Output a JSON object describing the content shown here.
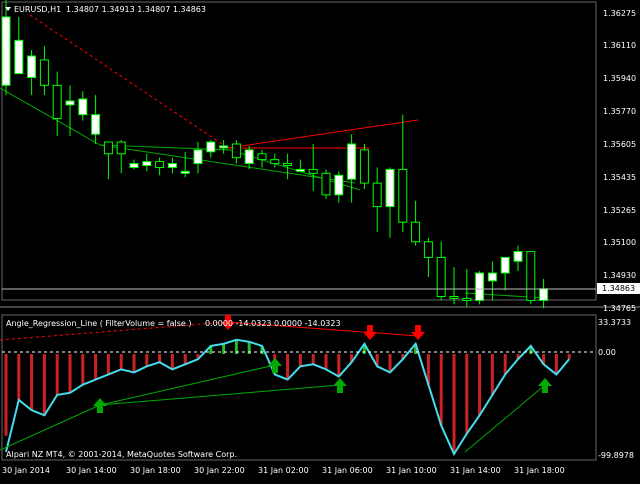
{
  "main": {
    "header": {
      "symbol": "EURUSD,H1",
      "ohlc": "1.34807 1.34913 1.34807 1.34863"
    },
    "price_axis": {
      "ticks": [
        "1.36275",
        "1.36110",
        "1.35940",
        "1.35770",
        "1.35605",
        "1.35435",
        "1.35265",
        "1.35100",
        "1.34930"
      ],
      "current_price": "1.34863",
      "bottom_label": "1.34765"
    }
  },
  "indicator": {
    "header": {
      "title": "Angle_Regression_Line ( FilterVolume = false )",
      "values": "0.0000 -14.0323 0.0000 -14.0323"
    },
    "axis": {
      "top": "33.3733",
      "zero": "0.00",
      "bottom": "-99.8978"
    }
  },
  "time_axis": {
    "labels": [
      "30 Jan 2014",
      "30 Jan 14:00",
      "30 Jan 18:00",
      "30 Jan 22:00",
      "31 Jan 02:00",
      "31 Jan 06:00",
      "31 Jan 10:00",
      "31 Jan 14:00",
      "31 Jan 18:00"
    ]
  },
  "footer": {
    "copyright": "Alpari NZ MT4, © 2001-2014, MetaQuotes Software Corp."
  },
  "colors": {
    "background": "#000000",
    "bull_candle": "#ffffff",
    "bear_candle": "#000000",
    "candle_outline": "#00ff00",
    "regression_line": "#00aa00",
    "trend_line": "#ff0000",
    "osc_line": "#44ddee",
    "hist_neg": "#cc2222",
    "hist_pos": "#22bb22",
    "arrow_up": "#00aa00",
    "arrow_down": "#ff0000"
  },
  "chart_data": {
    "type": "candlestick",
    "candles": [
      {
        "o": 1.359,
        "h": 1.3645,
        "l": 1.3585,
        "c": 1.3625
      },
      {
        "o": 1.3596,
        "h": 1.3625,
        "l": 1.3596,
        "c": 1.3613
      },
      {
        "o": 1.3594,
        "h": 1.3608,
        "l": 1.3585,
        "c": 1.3605
      },
      {
        "o": 1.3603,
        "h": 1.361,
        "l": 1.3585,
        "c": 1.359
      },
      {
        "o": 1.359,
        "h": 1.3597,
        "l": 1.3564,
        "c": 1.3573
      },
      {
        "o": 1.358,
        "h": 1.359,
        "l": 1.3564,
        "c": 1.3582
      },
      {
        "o": 1.3575,
        "h": 1.3587,
        "l": 1.3572,
        "c": 1.3583
      },
      {
        "o": 1.3565,
        "h": 1.3585,
        "l": 1.356,
        "c": 1.3575
      },
      {
        "o": 1.3561,
        "h": 1.3561,
        "l": 1.3542,
        "c": 1.3555
      },
      {
        "o": 1.3561,
        "h": 1.3562,
        "l": 1.3545,
        "c": 1.3555
      },
      {
        "o": 1.3548,
        "h": 1.3552,
        "l": 1.3547,
        "c": 1.355
      },
      {
        "o": 1.3549,
        "h": 1.3555,
        "l": 1.3546,
        "c": 1.3551
      },
      {
        "o": 1.3551,
        "h": 1.3553,
        "l": 1.3544,
        "c": 1.3548
      },
      {
        "o": 1.3548,
        "h": 1.3553,
        "l": 1.3545,
        "c": 1.355
      },
      {
        "o": 1.3545,
        "h": 1.3556,
        "l": 1.3543,
        "c": 1.3546
      },
      {
        "o": 1.355,
        "h": 1.3561,
        "l": 1.3545,
        "c": 1.3557
      },
      {
        "o": 1.3556,
        "h": 1.3562,
        "l": 1.3553,
        "c": 1.3561
      },
      {
        "o": 1.3558,
        "h": 1.3562,
        "l": 1.3555,
        "c": 1.3559
      },
      {
        "o": 1.356,
        "h": 1.3562,
        "l": 1.355,
        "c": 1.3553
      },
      {
        "o": 1.355,
        "h": 1.3559,
        "l": 1.3547,
        "c": 1.3557
      },
      {
        "o": 1.3555,
        "h": 1.3557,
        "l": 1.3548,
        "c": 1.3552
      },
      {
        "o": 1.3552,
        "h": 1.3555,
        "l": 1.3548,
        "c": 1.355
      },
      {
        "o": 1.355,
        "h": 1.3555,
        "l": 1.3542,
        "c": 1.3549
      },
      {
        "o": 1.3546,
        "h": 1.3552,
        "l": 1.3546,
        "c": 1.3547
      },
      {
        "o": 1.3547,
        "h": 1.356,
        "l": 1.3536,
        "c": 1.3545
      },
      {
        "o": 1.3545,
        "h": 1.3547,
        "l": 1.3532,
        "c": 1.3534
      },
      {
        "o": 1.3534,
        "h": 1.3546,
        "l": 1.353,
        "c": 1.3544
      },
      {
        "o": 1.3542,
        "h": 1.3565,
        "l": 1.353,
        "c": 1.356
      },
      {
        "o": 1.3557,
        "h": 1.356,
        "l": 1.3537,
        "c": 1.354
      },
      {
        "o": 1.354,
        "h": 1.3548,
        "l": 1.3515,
        "c": 1.3528
      },
      {
        "o": 1.3528,
        "h": 1.3548,
        "l": 1.3512,
        "c": 1.3547
      },
      {
        "o": 1.3547,
        "h": 1.3575,
        "l": 1.3515,
        "c": 1.352
      },
      {
        "o": 1.352,
        "h": 1.3531,
        "l": 1.3508,
        "c": 1.351
      },
      {
        "o": 1.351,
        "h": 1.3512,
        "l": 1.3492,
        "c": 1.3502
      },
      {
        "o": 1.3502,
        "h": 1.351,
        "l": 1.348,
        "c": 1.3482
      },
      {
        "o": 1.3482,
        "h": 1.3497,
        "l": 1.3478,
        "c": 1.3481
      },
      {
        "o": 1.3481,
        "h": 1.3496,
        "l": 1.3477,
        "c": 1.348
      },
      {
        "o": 1.348,
        "h": 1.3495,
        "l": 1.3478,
        "c": 1.3494
      },
      {
        "o": 1.349,
        "h": 1.35,
        "l": 1.348,
        "c": 1.3494
      },
      {
        "o": 1.3494,
        "h": 1.3502,
        "l": 1.3485,
        "c": 1.3502
      },
      {
        "o": 1.35,
        "h": 1.3508,
        "l": 1.3495,
        "c": 1.3505
      },
      {
        "o": 1.3505,
        "h": 1.3505,
        "l": 1.3478,
        "c": 1.348
      },
      {
        "o": 1.348,
        "h": 1.3491,
        "l": 1.3476,
        "c": 1.3486
      }
    ],
    "oscillator": [
      -96,
      -45,
      -55,
      -60,
      -40,
      -38,
      -30,
      -25,
      -20,
      -15,
      -18,
      -12,
      -8,
      -15,
      -10,
      -5,
      8,
      10,
      14,
      12,
      8,
      -20,
      -25,
      -12,
      -10,
      -15,
      -22,
      -8,
      10,
      -12,
      -18,
      -5,
      10,
      -30,
      -70,
      -98,
      -78,
      -60,
      -40,
      -20,
      -5,
      8,
      -10,
      -20,
      -5
    ],
    "histogram": [
      -80,
      -45,
      -55,
      -60,
      -40,
      -38,
      -30,
      -25,
      -20,
      -15,
      -18,
      -12,
      -8,
      -15,
      -10,
      -5,
      8,
      10,
      14,
      12,
      8,
      -20,
      -25,
      -12,
      -10,
      -15,
      -22,
      -8,
      10,
      -12,
      -18,
      -5,
      10,
      -30,
      -70,
      -98,
      -78,
      -60,
      -40,
      -20,
      -5,
      8,
      -10,
      -20,
      -5
    ],
    "osc_range": [
      -99.8978,
      33.3733
    ]
  }
}
